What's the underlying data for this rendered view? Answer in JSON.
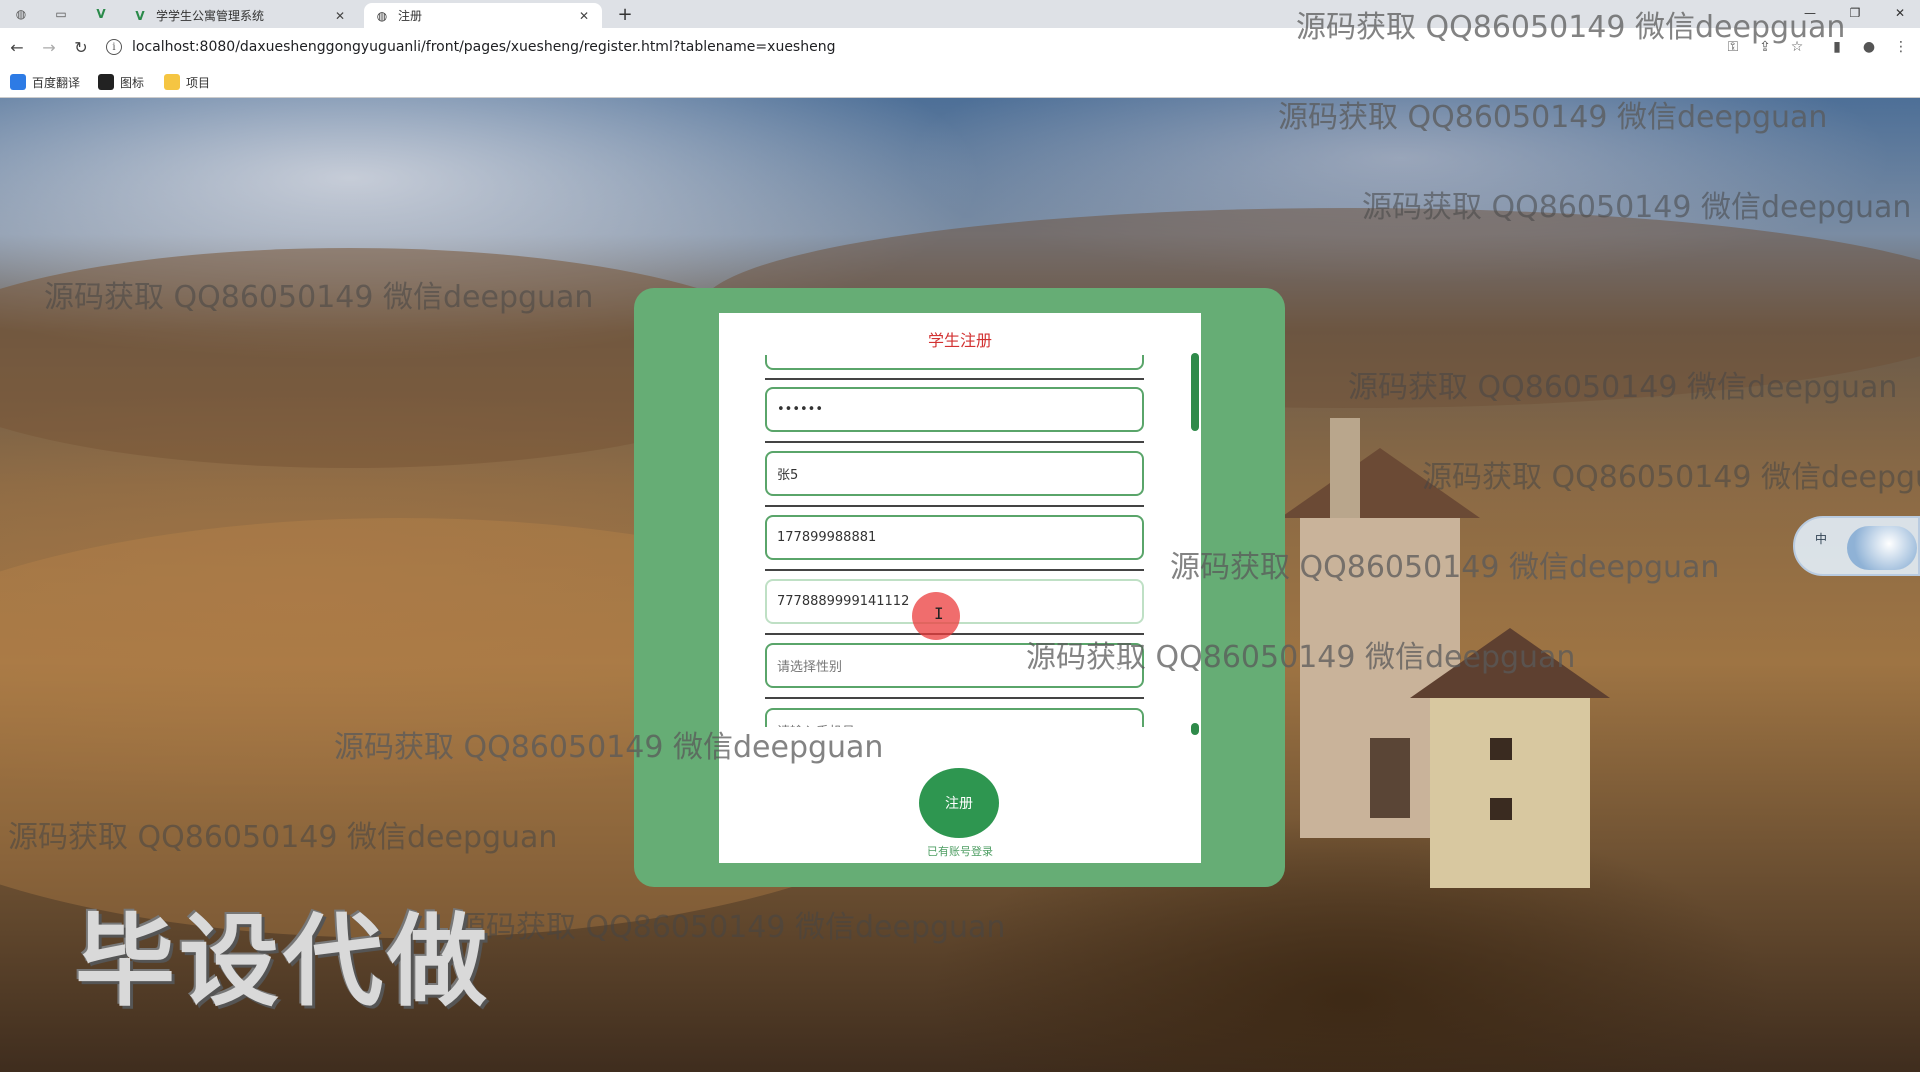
{
  "browser": {
    "tabs": [
      {
        "title": "学学生公寓管理系统",
        "active": false
      },
      {
        "title": "注册",
        "active": true
      }
    ],
    "new_tab": "+",
    "url": "localhost:8080/daxueshenggongyuguanli/front/pages/xuesheng/register.html?tablename=xuesheng",
    "bookmarks": [
      "百度翻译",
      "图标",
      "项目"
    ],
    "icons": {
      "back": "←",
      "forward": "→",
      "reload": "↻",
      "info": "i",
      "key": "⚿",
      "share": "⇪",
      "star": "☆",
      "sidebar": "▮",
      "profile": "●",
      "menu": "⋮",
      "minimize": "—",
      "restore": "❐",
      "close": "✕",
      "tab_close": "✕"
    }
  },
  "form": {
    "title": "学生注册",
    "fields": {
      "password": "••••••",
      "name": "张5",
      "phone": "177899988881",
      "id_card": "7778889999141112"
    },
    "gender_placeholder": "请选择性别",
    "next_placeholder": "请输入手机号",
    "register_label": "注册",
    "login_link": "已有账号登录"
  },
  "widget": {
    "label": "中"
  },
  "overlays": {
    "watermark": "源码获取 QQ86050149 微信deepguan",
    "stamp": "毕设代做"
  },
  "colors": {
    "card_green": "#66ad75",
    "button_green": "#2e9650",
    "title_red": "#d23232",
    "border_green": "#5aa56a"
  }
}
